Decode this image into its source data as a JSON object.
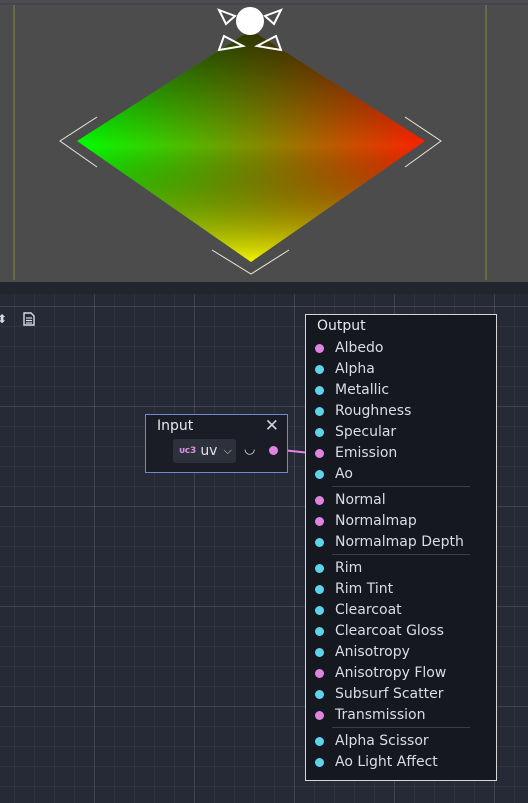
{
  "viewport": {
    "gradient": [
      "#00ff00",
      "#ff2000",
      "#ffff00",
      "#1a4a00"
    ]
  },
  "toolbar": {
    "icons": [
      "chevron-updown-icon",
      "document-icon"
    ]
  },
  "input_node": {
    "title": "Input",
    "close_glyph": "✕",
    "type_badge": "vec3",
    "type_badge_display": "ᴜᴄ3",
    "selected": "uv",
    "chevron": "⌵",
    "eye_glyph": "◡"
  },
  "output_node": {
    "title": "Output",
    "ports": [
      {
        "label": "Albedo",
        "type": "vec3"
      },
      {
        "label": "Alpha",
        "type": "float"
      },
      {
        "label": "Metallic",
        "type": "float"
      },
      {
        "label": "Roughness",
        "type": "float"
      },
      {
        "label": "Specular",
        "type": "float"
      },
      {
        "label": "Emission",
        "type": "vec3"
      },
      {
        "label": "Ao",
        "type": "float"
      },
      {
        "label": "Normal",
        "type": "vec3"
      },
      {
        "label": "Normalmap",
        "type": "vec3"
      },
      {
        "label": "Normalmap Depth",
        "type": "float"
      },
      {
        "label": "Rim",
        "type": "float"
      },
      {
        "label": "Rim Tint",
        "type": "float"
      },
      {
        "label": "Clearcoat",
        "type": "float"
      },
      {
        "label": "Clearcoat Gloss",
        "type": "float"
      },
      {
        "label": "Anisotropy",
        "type": "float"
      },
      {
        "label": "Anisotropy Flow",
        "type": "vec3"
      },
      {
        "label": "Subsurf Scatter",
        "type": "float"
      },
      {
        "label": "Transmission",
        "type": "vec3"
      },
      {
        "label": "Alpha Scissor",
        "type": "float"
      },
      {
        "label": "Ao Light Affect",
        "type": "float"
      }
    ]
  },
  "colors": {
    "vec3_port": "#df85e1",
    "float_port": "#5ed4ea",
    "connection": "#df85e1"
  }
}
